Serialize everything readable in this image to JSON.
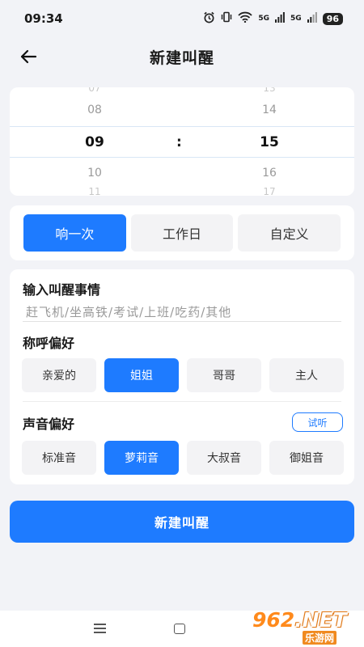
{
  "status_bar": {
    "time": "09:34",
    "signal_1": "5G",
    "signal_2": "5G",
    "battery": "96"
  },
  "header": {
    "title": "新建叫醒"
  },
  "time_picker": {
    "hours": {
      "faint_above": "07",
      "prev": "08",
      "selected": "09",
      "next": "10",
      "faint_below": "11"
    },
    "minutes": {
      "faint_above": "13",
      "prev": "14",
      "selected": "15",
      "next": "16",
      "faint_below": "17"
    },
    "separator": ":"
  },
  "repeat": {
    "options": [
      {
        "label": "响一次",
        "selected": true
      },
      {
        "label": "工作日",
        "selected": false
      },
      {
        "label": "自定义",
        "selected": false
      }
    ]
  },
  "form": {
    "event_label": "输入叫醒事情",
    "event_placeholder": "赶飞机/坐高铁/考试/上班/吃药/其他",
    "address_label": "称呼偏好",
    "address_options": [
      {
        "label": "亲爱的",
        "selected": false
      },
      {
        "label": "姐姐",
        "selected": true
      },
      {
        "label": "哥哥",
        "selected": false
      },
      {
        "label": "主人",
        "selected": false
      }
    ],
    "voice_label": "声音偏好",
    "try_listen": "试听",
    "voice_options": [
      {
        "label": "标准音",
        "selected": false
      },
      {
        "label": "萝莉音",
        "selected": true
      },
      {
        "label": "大叔音",
        "selected": false
      },
      {
        "label": "御姐音",
        "selected": false
      }
    ]
  },
  "create_button": "新建叫醒",
  "watermark": {
    "logo_prefix": "",
    "logo_number": "962",
    "logo_suffix": ".NET",
    "subtitle": "乐游网"
  },
  "colors": {
    "accent": "#1e7bff",
    "background": "#f2f3f7"
  }
}
